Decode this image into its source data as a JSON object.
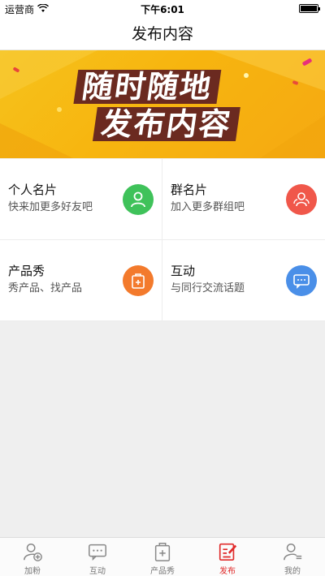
{
  "status_bar": {
    "carrier": "运营商",
    "time": "下午6:01"
  },
  "nav": {
    "title": "发布内容"
  },
  "banner": {
    "line1": "随时随地",
    "line2": "发布内容"
  },
  "cards": [
    {
      "title": "个人名片",
      "subtitle": "快来加更多好友吧",
      "icon": "person-icon",
      "color": "#3fc25a"
    },
    {
      "title": "群名片",
      "subtitle": "加入更多群组吧",
      "icon": "group-icon",
      "color": "#f0574a"
    },
    {
      "title": "产品秀",
      "subtitle": "秀产品、找产品",
      "icon": "product-bag-icon",
      "color": "#f37a2c"
    },
    {
      "title": "互动",
      "subtitle": "与同行交流话题",
      "icon": "chat-icon",
      "color": "#4a8fe8"
    }
  ],
  "tabs": [
    {
      "label": "加粉",
      "icon": "add-user-icon",
      "active": false
    },
    {
      "label": "互动",
      "icon": "chat-icon",
      "active": false
    },
    {
      "label": "产品秀",
      "icon": "product-bag-icon",
      "active": false
    },
    {
      "label": "发布",
      "icon": "edit-icon",
      "active": true
    },
    {
      "label": "我的",
      "icon": "profile-icon",
      "active": false
    }
  ],
  "colors": {
    "active_tab": "#e02a2a",
    "inactive_tab": "#777777",
    "banner_bg": "#f6b914"
  }
}
